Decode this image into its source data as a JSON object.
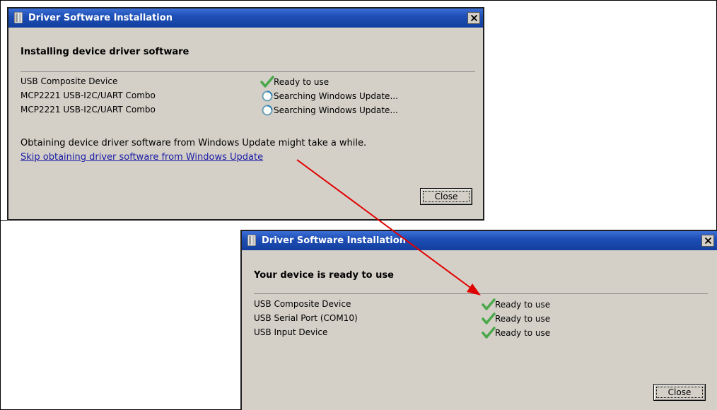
{
  "dialog_top": {
    "title": "Driver Software Installation",
    "close_glyph": "✕",
    "heading": "Installing device driver software",
    "devices": [
      {
        "name": "USB Composite Device",
        "status": "Ready to use",
        "status_icon": "check-icon"
      },
      {
        "name": "MCP2221 USB-I2C/UART Combo",
        "status": "Searching Windows Update...",
        "status_icon": "searching-icon"
      },
      {
        "name": "MCP2221 USB-I2C/UART Combo",
        "status": "Searching Windows Update...",
        "status_icon": "searching-icon"
      }
    ],
    "info_text": "Obtaining device driver software from Windows Update might take a while.",
    "skip_link": "Skip obtaining driver software from Windows Update",
    "close_button": "Close"
  },
  "dialog_bottom": {
    "title": "Driver Software Installation",
    "close_glyph": "✕",
    "heading": "Your device is ready to use",
    "devices": [
      {
        "name": "USB Composite Device",
        "status": "Ready to use",
        "status_icon": "check-icon"
      },
      {
        "name": "USB Serial Port (COM10)",
        "status": "Ready to use",
        "status_icon": "check-icon"
      },
      {
        "name": "USB Input Device",
        "status": "Ready to use",
        "status_icon": "check-icon"
      }
    ],
    "close_button": "Close"
  },
  "colors": {
    "titlebar": "#1f4fb6",
    "dialog_bg": "#d4d0c8",
    "link": "#1a1aa6",
    "check": "#4aa84a",
    "annotation_arrow": "#e00000"
  }
}
